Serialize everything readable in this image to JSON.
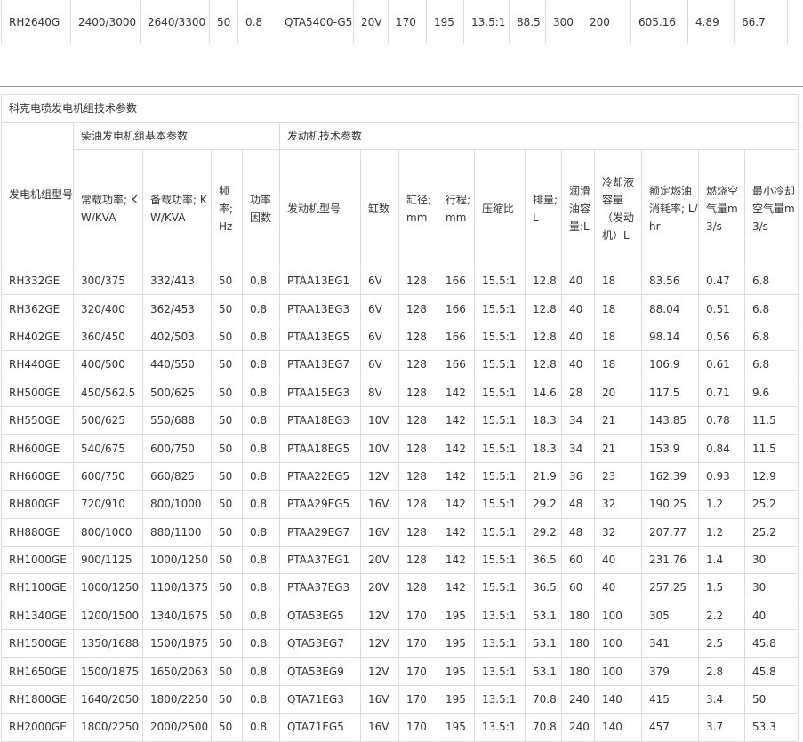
{
  "top_row": [
    "RH2640G",
    "2400/3000",
    "2640/3300",
    "50",
    "0.8",
    "QTA5400-G5",
    "20V",
    "170",
    "195",
    "13.5:1",
    "88.5",
    "300",
    "200",
    "605.16",
    "4.89",
    "66.7"
  ],
  "table": {
    "title": "科克电喷发电机组技术参数",
    "model_header": "发电机组型号",
    "group_genset": "柴油发电机组基本参数",
    "group_engine": "发动机技术参数",
    "headers": [
      "常载功率; KW/KVA",
      "备载功率; KW/KVA",
      "频率; Hz",
      "功率因数",
      "发动机型号",
      "缸数",
      "缸径; mm",
      "行程; mm",
      "压缩比",
      "排量; L",
      "润滑油容量:L",
      "冷却液容量（发动机）L",
      "额定燃油消耗率; L/hr",
      "燃烧空气量m3/s",
      "最小冷却空气量m3/s"
    ],
    "rows": [
      [
        "RH332GE",
        "300/375",
        "332/413",
        "50",
        "0.8",
        "PTAA13EG1",
        "6V",
        "128",
        "166",
        "15.5:1",
        "12.8",
        "40",
        "18",
        "83.56",
        "0.47",
        "6.8"
      ],
      [
        "RH362GE",
        "320/400",
        "362/453",
        "50",
        "0.8",
        "PTAA13EG3",
        "6V",
        "128",
        "166",
        "15.5:1",
        "12.8",
        "40",
        "18",
        "88.04",
        "0.51",
        "6.8"
      ],
      [
        "RH402GE",
        "360/450",
        "402/503",
        "50",
        "0.8",
        "PTAA13EG5",
        "6V",
        "128",
        "166",
        "15.5:1",
        "12.8",
        "40",
        "18",
        "98.14",
        "0.56",
        "6.8"
      ],
      [
        "RH440GE",
        "400/500",
        "440/550",
        "50",
        "0.8",
        "PTAA13EG7",
        "6V",
        "128",
        "166",
        "15.5:1",
        "12.8",
        "40",
        "18",
        "106.9",
        "0.61",
        "6.8"
      ],
      [
        "RH500GE",
        "450/562.5",
        "500/625",
        "50",
        "0.8",
        "PTAA15EG3",
        "8V",
        "128",
        "142",
        "15.5:1",
        "14.6",
        "28",
        "20",
        "117.5",
        "0.71",
        "9.6"
      ],
      [
        "RH550GE",
        "500/625",
        "550/688",
        "50",
        "0.8",
        "PTAA18EG3",
        "10V",
        "128",
        "142",
        "15.5:1",
        "18.3",
        "34",
        "21",
        "143.85",
        "0.78",
        "11.5"
      ],
      [
        "RH600GE",
        "540/675",
        "600/750",
        "50",
        "0.8",
        "PTAA18EG5",
        "10V",
        "128",
        "142",
        "15.5:1",
        "18.3",
        "34",
        "21",
        "153.9",
        "0.84",
        "11.5"
      ],
      [
        "RH660GE",
        "600/750",
        "660/825",
        "50",
        "0.8",
        "PTAA22EG5",
        "12V",
        "128",
        "142",
        "15.5:1",
        "21.9",
        "36",
        "23",
        "162.39",
        "0.93",
        "12.9"
      ],
      [
        "RH800GE",
        "720/910",
        "800/1000",
        "50",
        "0.8",
        "PTAA29EG5",
        "16V",
        "128",
        "142",
        "15.5:1",
        "29.2",
        "48",
        "32",
        "190.25",
        "1.2",
        "25.2"
      ],
      [
        "RH880GE",
        "800/1000",
        "880/1100",
        "50",
        "0.8",
        "PTAA29EG7",
        "16V",
        "128",
        "142",
        "15.5:1",
        "29.2",
        "48",
        "32",
        "207.77",
        "1.2",
        "25.2"
      ],
      [
        "RH1000GE",
        "900/1125",
        "1000/1250",
        "50",
        "0.8",
        "PTAA37EG1",
        "20V",
        "128",
        "142",
        "15.5:1",
        "36.5",
        "60",
        "40",
        "231.76",
        "1.4",
        "30"
      ],
      [
        "RH1100GE",
        "1000/1250",
        "1100/1375",
        "50",
        "0.8",
        "PTAA37EG3",
        "20V",
        "128",
        "142",
        "15.5:1",
        "36.5",
        "60",
        "40",
        "257.25",
        "1.5",
        "30"
      ],
      [
        "RH1340GE",
        "1200/1500",
        "1340/1675",
        "50",
        "0.8",
        "QTA53EG5",
        "12V",
        "170",
        "195",
        "13.5:1",
        "53.1",
        "180",
        "100",
        "305",
        "2.2",
        "40"
      ],
      [
        "RH1500GE",
        "1350/1688",
        "1500/1875",
        "50",
        "0.8",
        "QTA53EG7",
        "12V",
        "170",
        "195",
        "13.5:1",
        "53.1",
        "180",
        "100",
        "341",
        "2.5",
        "45.8"
      ],
      [
        "RH1650GE",
        "1500/1875",
        "1650/2063",
        "50",
        "0.8",
        "QTA53EG9",
        "12V",
        "170",
        "195",
        "13.5:1",
        "53.1",
        "180",
        "100",
        "379",
        "2.8",
        "45.8"
      ],
      [
        "RH1800GE",
        "1640/2050",
        "1800/2250",
        "50",
        "0.8",
        "QTA71EG3",
        "16V",
        "170",
        "195",
        "13.5:1",
        "70.8",
        "240",
        "140",
        "415",
        "3.4",
        "50"
      ],
      [
        "RH2000GE",
        "1800/2250",
        "2000/2500",
        "50",
        "0.8",
        "QTA71EG5",
        "16V",
        "170",
        "195",
        "13.5:1",
        "70.8",
        "240",
        "140",
        "457",
        "3.7",
        "53.3"
      ]
    ]
  }
}
